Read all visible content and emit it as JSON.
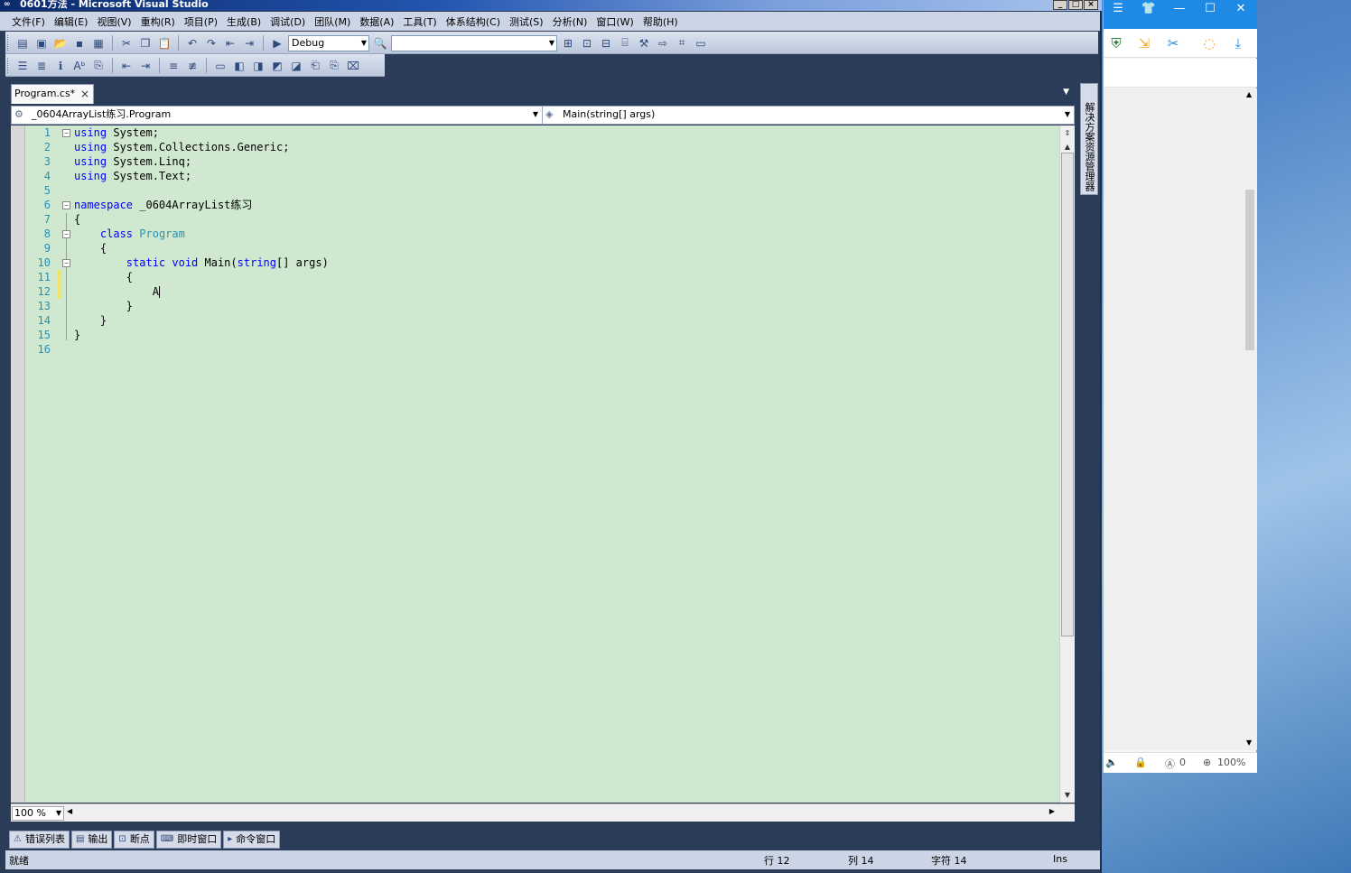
{
  "window": {
    "title": "0601方法 - Microsoft Visual Studio",
    "controls": [
      "_",
      "□",
      "×"
    ]
  },
  "menubar": {
    "items": [
      "文件(F)",
      "编辑(E)",
      "视图(V)",
      "重构(R)",
      "项目(P)",
      "生成(B)",
      "调试(D)",
      "团队(M)",
      "数据(A)",
      "工具(T)",
      "体系结构(C)",
      "测试(S)",
      "分析(N)",
      "窗口(W)",
      "帮助(H)"
    ]
  },
  "toolbar": {
    "configuration": "Debug",
    "find_value": ""
  },
  "editor": {
    "tab_label": "Program.cs*",
    "tab_close": "×",
    "nav_class": "_0604ArrayList练习.Program",
    "nav_member": "Main(string[] args)",
    "zoom": "100 %",
    "lines": [
      {
        "num": "1",
        "kw": "using",
        "rest": " System;"
      },
      {
        "num": "2",
        "kw": "using",
        "rest": " System.Collections.Generic;"
      },
      {
        "num": "3",
        "kw": "using",
        "rest": " System.Linq;"
      },
      {
        "num": "4",
        "kw": "using",
        "rest": " System.Text;"
      },
      {
        "num": "5",
        "kw": "",
        "rest": ""
      },
      {
        "num": "6",
        "kw": "namespace",
        "rest": " _0604ArrayList练习"
      },
      {
        "num": "7",
        "kw": "",
        "rest": "{"
      },
      {
        "num": "8",
        "kw": "class",
        "type": "Program",
        "indent": "    "
      },
      {
        "num": "9",
        "kw": "",
        "rest": "    {"
      },
      {
        "num": "10",
        "kw": "static void",
        "rest": " Main(",
        "kw2": "string",
        "rest2": "[] args)",
        "indent": "        "
      },
      {
        "num": "11",
        "kw": "",
        "rest": "        {"
      },
      {
        "num": "12",
        "kw": "",
        "rest": "            A"
      },
      {
        "num": "13",
        "kw": "",
        "rest": "        }"
      },
      {
        "num": "14",
        "kw": "",
        "rest": "    }"
      },
      {
        "num": "15",
        "kw": "",
        "rest": "}"
      },
      {
        "num": "16",
        "kw": "",
        "rest": ""
      }
    ]
  },
  "side_dock": {
    "label": "解决方案资源管理器"
  },
  "bottom_tabs": [
    "错误列表",
    "输出",
    "断点",
    "即时窗口",
    "命令窗口"
  ],
  "status": {
    "ready": "就绪",
    "row": "行 12",
    "col": "列 14",
    "char": "字符 14",
    "mode": "Ins"
  },
  "browser": {
    "status_count": "0",
    "zoom": "100%"
  }
}
